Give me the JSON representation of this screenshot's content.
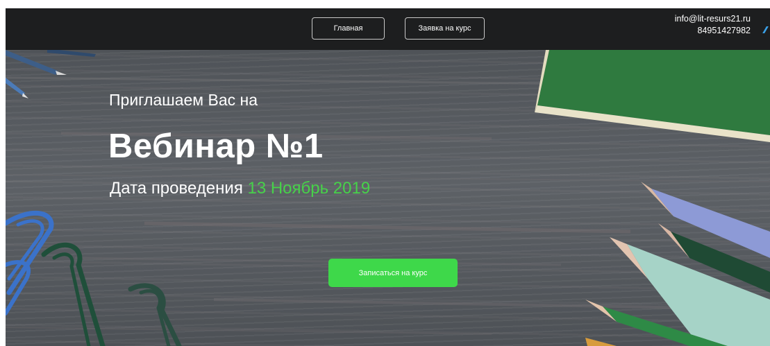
{
  "nav": {
    "home_label": "Главная",
    "apply_label": "Заявка на курс"
  },
  "contacts": {
    "email": "info@lit-resurs21.ru",
    "phone": "84951427982"
  },
  "hero": {
    "invite_text": "Приглашаем Вас на",
    "title": "Вебинар №1",
    "date_label": "Дата проведения ",
    "date_value": "13 Ноябрь 2019",
    "cta_label": "Записаться на курс"
  },
  "colors": {
    "navbar_bg": "#1d1e1f",
    "accent_green": "#3ed84a",
    "date_green": "#47d14a",
    "text_white": "#ffffff"
  },
  "icons": [
    "pen-decoration",
    "paper-clip-decoration",
    "notebook-decoration",
    "pencil-decoration"
  ]
}
